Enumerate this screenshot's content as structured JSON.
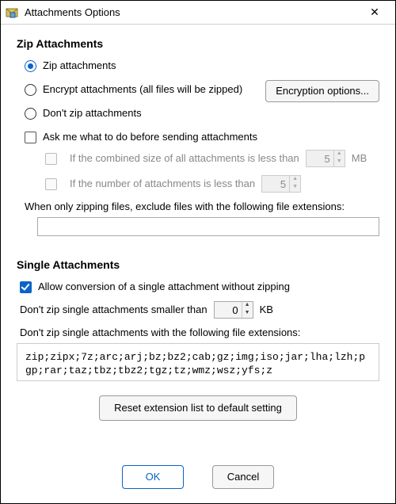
{
  "window": {
    "title": "Attachments Options"
  },
  "zip": {
    "section_title": "Zip Attachments",
    "opt_zip": "Zip attachments",
    "opt_encrypt": "Encrypt attachments (all files will be zipped)",
    "enc_button": "Encryption options...",
    "opt_dont": "Don't zip attachments",
    "ask_label": "Ask me what to do before sending attachments",
    "ask_size_label": "If the combined size of all attachments is less than",
    "ask_size_value": "5",
    "ask_size_unit": "MB",
    "ask_count_label": "If the number of attachments is less than",
    "ask_count_value": "5",
    "exclude_label": "When only zipping files, exclude files with the following file extensions:",
    "exclude_value": ""
  },
  "single": {
    "section_title": "Single Attachments",
    "allow_label": "Allow conversion of a single attachment without zipping",
    "smaller_label": "Don't zip single attachments smaller than",
    "smaller_value": "0",
    "smaller_unit": "KB",
    "ext_label": "Don't zip single attachments with the following file extensions:",
    "ext_value": "zip;zipx;7z;arc;arj;bz;bz2;cab;gz;img;iso;jar;lha;lzh;pgp;rar;taz;tbz;tbz2;tgz;tz;wmz;wsz;yfs;z",
    "reset_button": "Reset extension list to default setting"
  },
  "buttons": {
    "ok": "OK",
    "cancel": "Cancel"
  }
}
